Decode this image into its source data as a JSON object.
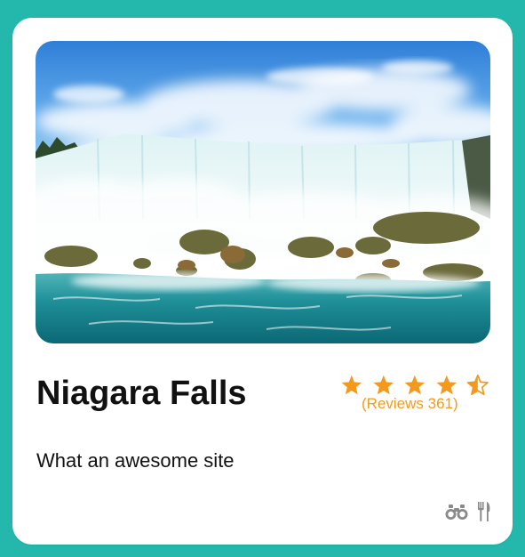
{
  "colors": {
    "background": "#24b8ad",
    "card": "#ffffff",
    "accent_orange": "#f39a1e",
    "title_text": "#111111",
    "icon_gray": "#8a8a8a"
  },
  "card": {
    "image_alt": "Niagara Falls",
    "title": "Niagara Falls",
    "rating": {
      "value": 4.5,
      "max": 5,
      "reviews_label": "(Reviews 361)"
    },
    "description": "What an awesome site",
    "amenity_icons": [
      "binoculars-icon",
      "fork-knife-icon"
    ]
  }
}
